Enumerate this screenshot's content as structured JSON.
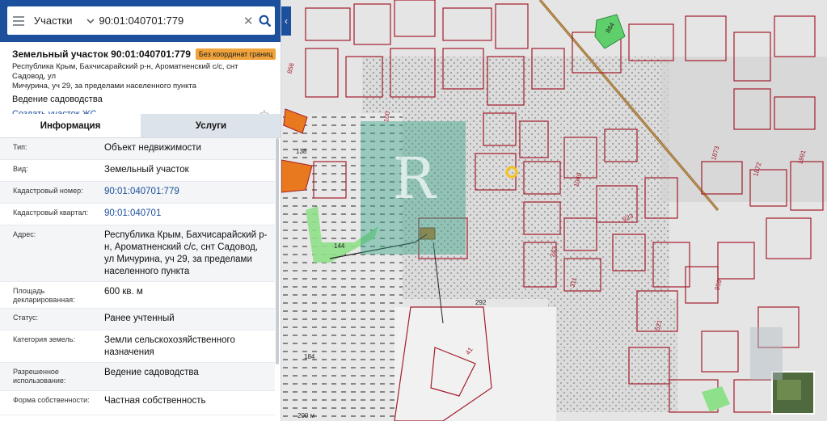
{
  "search": {
    "type_label": "Участки",
    "query": "90:01:040701:779"
  },
  "card": {
    "title": "Земельный участок 90:01:040701:779",
    "badge": "Без координат границ",
    "address_line1": "Республика Крым, Бахчисарайский р-н, Ароматненский с/с, снт Садовод, ул",
    "address_line2": "Мичурина, уч 29, за пределами населенного пункта",
    "use": "Ведение садоводства",
    "create_link": "Создать участок ЖС →"
  },
  "tabs": [
    {
      "label": "Информация",
      "active": true
    },
    {
      "label": "Услуги",
      "active": false
    }
  ],
  "info_rows": [
    {
      "key": "Тип:",
      "value": "Объект недвижимости"
    },
    {
      "key": "Вид:",
      "value": "Земельный участок"
    },
    {
      "key": "Кадастровый номер:",
      "value": "90:01:040701:779"
    },
    {
      "key": "Кадастровый квартал:",
      "value": "90:01:040701"
    },
    {
      "key": "Адрес:",
      "value": "Республика Крым, Бахчисарайский р-н, Ароматненский с/с, снт Садовод, ул Мичурина, уч 29, за пределами населенного пункта"
    },
    {
      "key": "Площадь декларированная:",
      "value": "600 кв. м"
    },
    {
      "key": "Статус:",
      "value": "Ранее учтенный"
    },
    {
      "key": "Категория земель:",
      "value": "Земли сельскохозяйственного назначения"
    },
    {
      "key": "Разрешенное использование:",
      "value": "Ведение садоводства"
    },
    {
      "key": "Форма собственности:",
      "value": "Частная собственность"
    }
  ],
  "map": {
    "labels": [
      "856",
      "138",
      "100",
      "1049",
      "923",
      "243",
      "311",
      "521",
      "959",
      "41",
      "864",
      "1873",
      "1872",
      "1991",
      "144",
      "184",
      "292",
      "200 м"
    ],
    "colors": {
      "parcel_line": "#a31d2b",
      "orange_parcel": "#e8791f",
      "green_parcel": "#8fe08a",
      "watermark": "#3aa588",
      "brand": "#1c4f9c",
      "badge": "#f0a33a"
    }
  },
  "icons": {
    "menu": "menu-icon",
    "chevron": "chevron-down-icon",
    "clear": "close-icon",
    "search": "search-icon",
    "collapse": "chevron-left-icon",
    "favorite": "star-icon"
  }
}
